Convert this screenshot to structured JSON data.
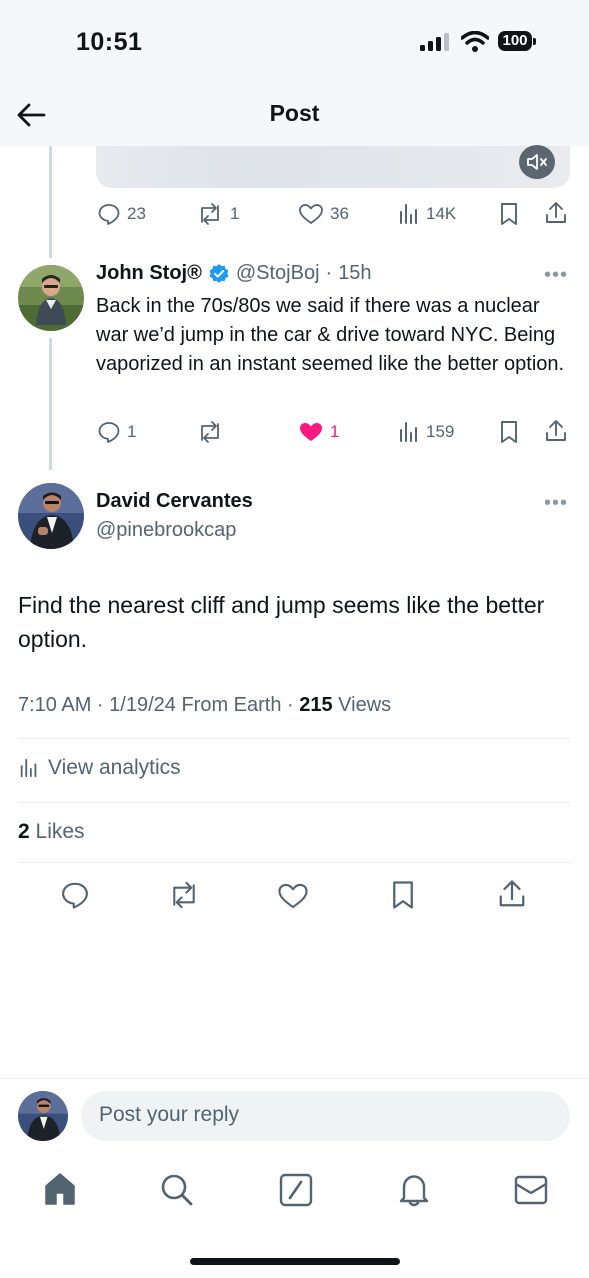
{
  "status_bar": {
    "time": "10:51",
    "battery": "100"
  },
  "header": {
    "title": "Post"
  },
  "previous_post_actions": {
    "replies": "23",
    "reposts": "1",
    "likes": "36",
    "views": "14K"
  },
  "reply_post": {
    "author_name": "John Stoj®",
    "handle": "@StojBoj",
    "separator": "·",
    "time_ago": "15h",
    "text": "Back in the 70s/80s we said if there was a nuclear war we’d jump in the car & drive toward NYC. Being vaporized in an instant seemed like the better option.",
    "replies": "1",
    "likes": "1",
    "views": "159",
    "more": "•••"
  },
  "main_post": {
    "author_name": "David Cervantes",
    "handle": "@pinebrookcap",
    "text": "Find the nearest cliff and jump seems like the better option.",
    "timestamp": "7:10 AM · 1/19/24 From Earth · ",
    "views_count": "215",
    "views_label": " Views",
    "analytics_label": "View analytics",
    "likes_count": "2",
    "likes_label": " Likes",
    "more": "•••"
  },
  "composer": {
    "placeholder": "Post your reply"
  },
  "colors": {
    "accent": "#1d9bf0",
    "like": "#f91880",
    "text": "#0f1419",
    "muted": "#536471"
  },
  "icons": {
    "nav": [
      "home-icon",
      "search-icon",
      "compose-icon",
      "bell-icon",
      "mail-icon"
    ],
    "actions": [
      "reply-icon",
      "repost-icon",
      "like-icon",
      "views-icon",
      "bookmark-icon",
      "share-icon"
    ]
  }
}
